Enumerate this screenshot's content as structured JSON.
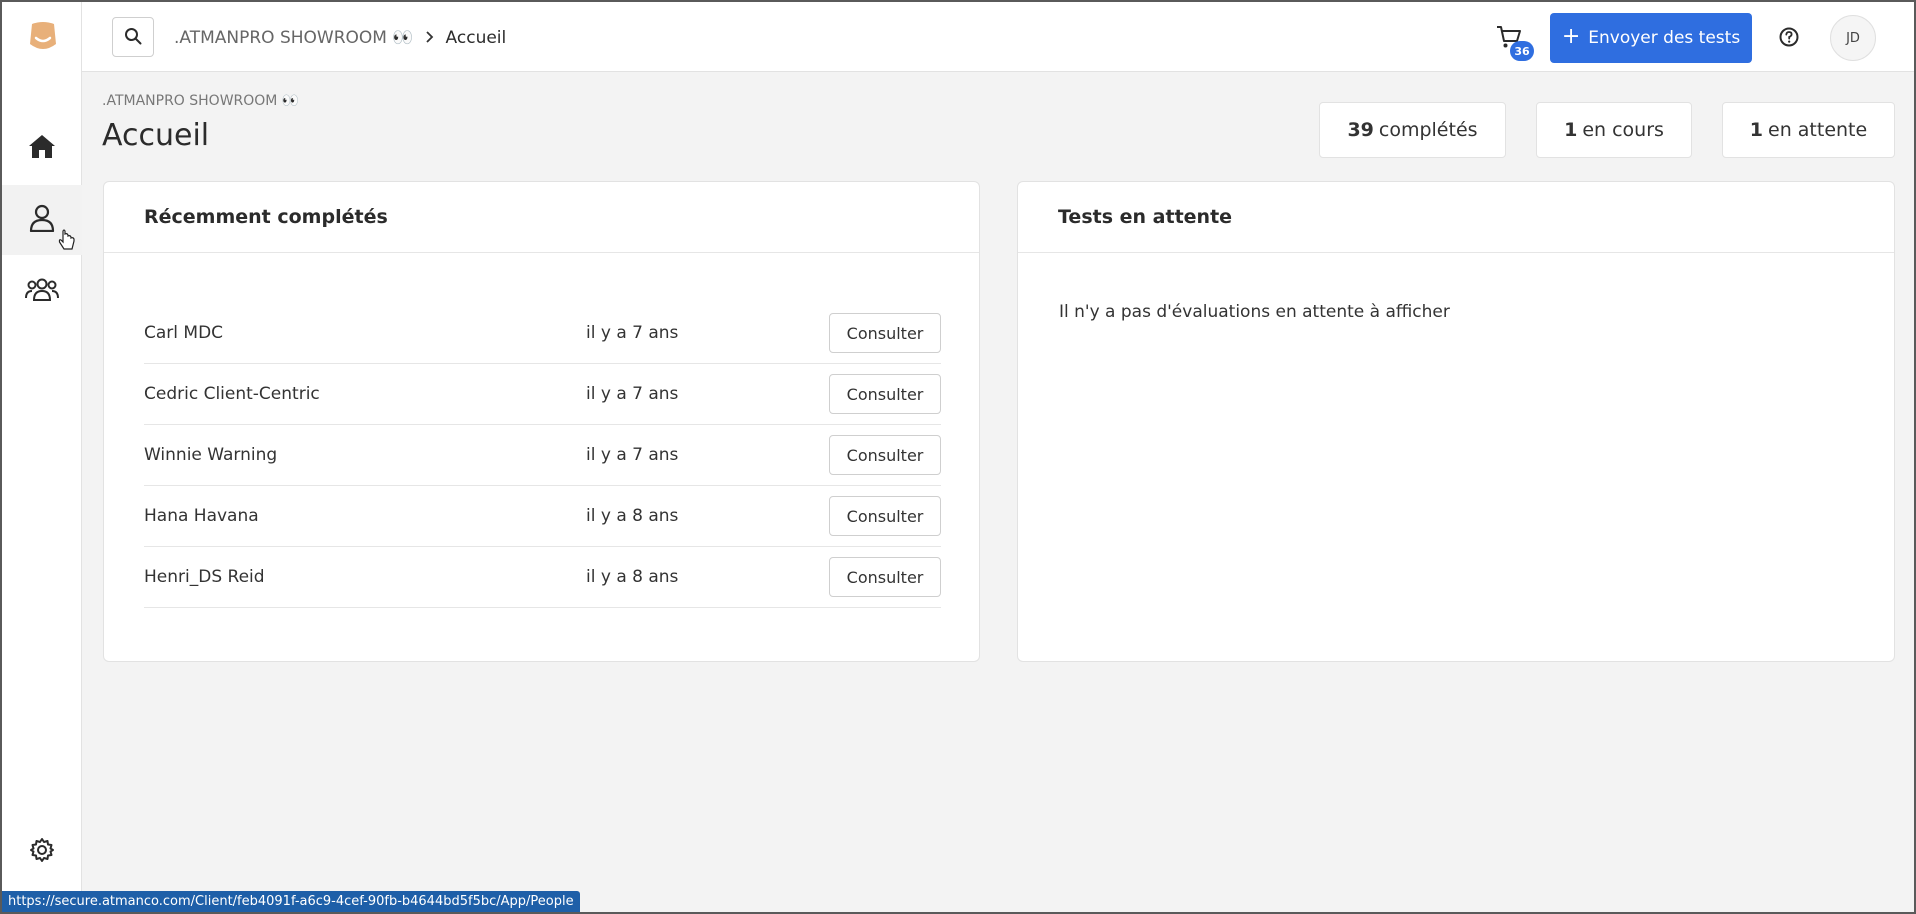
{
  "topbar": {
    "breadcrumb_org": ".ATMANPRO SHOWROOM 👀",
    "breadcrumb_current": "Accueil",
    "cart_count": "36",
    "send_tests_label": "Envoyer des tests",
    "avatar_initials": "JD"
  },
  "page": {
    "org_label": ".ATMANPRO SHOWROOM 👀",
    "title": "Accueil"
  },
  "stats": {
    "completed_count": "39",
    "completed_label": "complétés",
    "in_progress_count": "1",
    "in_progress_label": "en cours",
    "pending_count": "1",
    "pending_label": "en attente"
  },
  "recent": {
    "title": "Récemment complétés",
    "rows": [
      {
        "name": "Carl MDC",
        "when": "il y a 7 ans",
        "action": "Consulter"
      },
      {
        "name": "Cedric Client-Centric",
        "when": "il y a 7 ans",
        "action": "Consulter"
      },
      {
        "name": "Winnie Warning",
        "when": "il y a 7 ans",
        "action": "Consulter"
      },
      {
        "name": "Hana Havana",
        "when": "il y a 8 ans",
        "action": "Consulter"
      },
      {
        "name": "Henri_DS Reid",
        "when": "il y a 8 ans",
        "action": "Consulter"
      }
    ]
  },
  "pending": {
    "title": "Tests en attente",
    "empty_message": "Il n'y a pas d'évaluations en attente à afficher"
  },
  "statusbar": {
    "url": "https://secure.atmanco.com/Client/feb4091f-a6c9-4cef-90fb-b4644bd5f5bc/App/People"
  },
  "colors": {
    "accent": "#2f6ee0",
    "logo": "#e8b07a"
  },
  "icons": {
    "logo": "atman-logo-icon",
    "home": "home-icon",
    "people": "user-icon",
    "groups": "groups-icon",
    "settings": "gear-icon",
    "search": "search-icon",
    "cart": "cart-icon",
    "help": "help-icon"
  }
}
